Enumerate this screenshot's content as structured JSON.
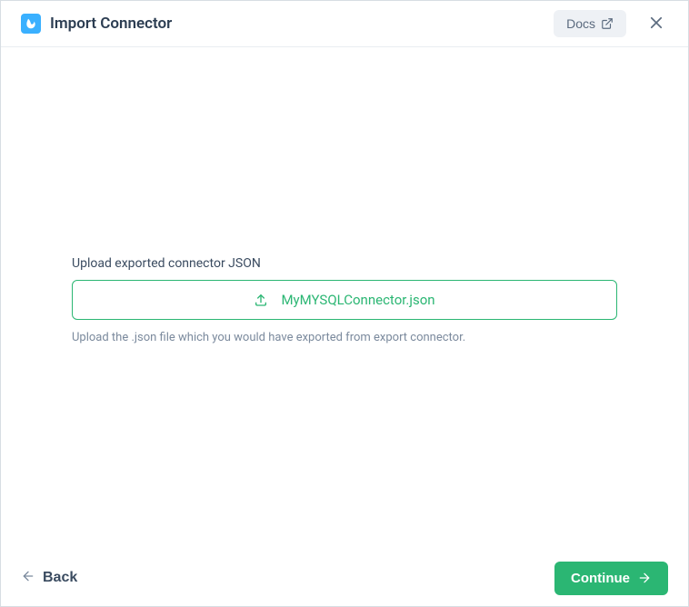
{
  "header": {
    "title": "Import Connector",
    "docs_label": "Docs"
  },
  "main": {
    "upload_label": "Upload exported connector JSON",
    "filename": "MyMYSQLConnector.json",
    "upload_hint": "Upload the .json file which you would have exported from export connector."
  },
  "footer": {
    "back_label": "Back",
    "continue_label": "Continue"
  },
  "colors": {
    "accent_green": "#2bb673",
    "icon_blue": "#3ab0ff"
  }
}
